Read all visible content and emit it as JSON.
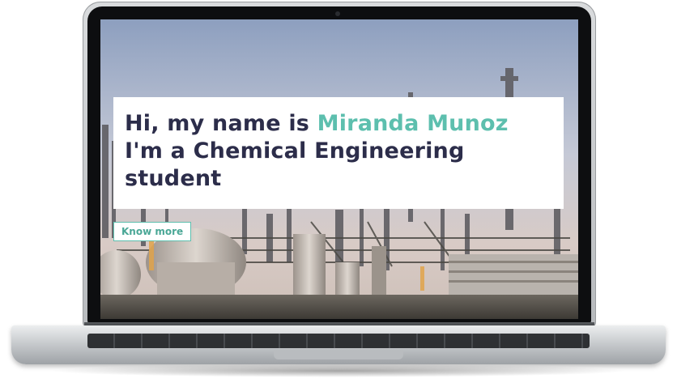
{
  "hero": {
    "greeting_prefix": "Hi, my name is ",
    "name": "Miranda Munoz",
    "line2": "I'm a Chemical Engineering",
    "line3": "student",
    "cta_label": "Know more"
  },
  "colors": {
    "accent": "#5dbfae",
    "heading": "#2c2d4a",
    "bezel": "#0d0e10"
  },
  "icons": {
    "camera": "webcam-icon"
  }
}
